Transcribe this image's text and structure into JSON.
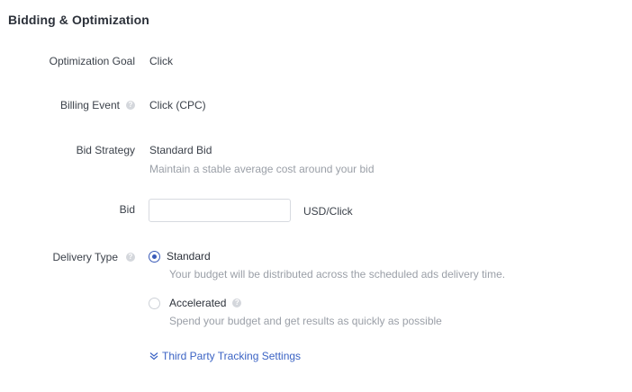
{
  "section": {
    "title": "Bidding & Optimization"
  },
  "optimization_goal": {
    "label": "Optimization Goal",
    "value": "Click"
  },
  "billing_event": {
    "label": "Billing Event",
    "value": "Click (CPC)",
    "help_icon": "question-circle"
  },
  "bid_strategy": {
    "label": "Bid Strategy",
    "value": "Standard Bid",
    "hint": "Maintain a stable average cost around your bid"
  },
  "bid": {
    "label": "Bid",
    "value": "",
    "unit": "USD/Click"
  },
  "delivery_type": {
    "label": "Delivery Type",
    "help_icon": "question-circle",
    "options": [
      {
        "label": "Standard",
        "hint": "Your budget will be distributed across the scheduled ads delivery time.",
        "selected": true
      },
      {
        "label": "Accelerated",
        "hint": "Spend your budget and get results as quickly as possible",
        "selected": false,
        "help_icon": "question-circle"
      }
    ]
  },
  "third_party": {
    "link_label": "Third Party Tracking Settings",
    "icon": "double-chevron-down"
  },
  "colors": {
    "accent": "#3b63c4",
    "radio_checked": "#3a5bb8",
    "hint_text": "#9a9fa7"
  }
}
